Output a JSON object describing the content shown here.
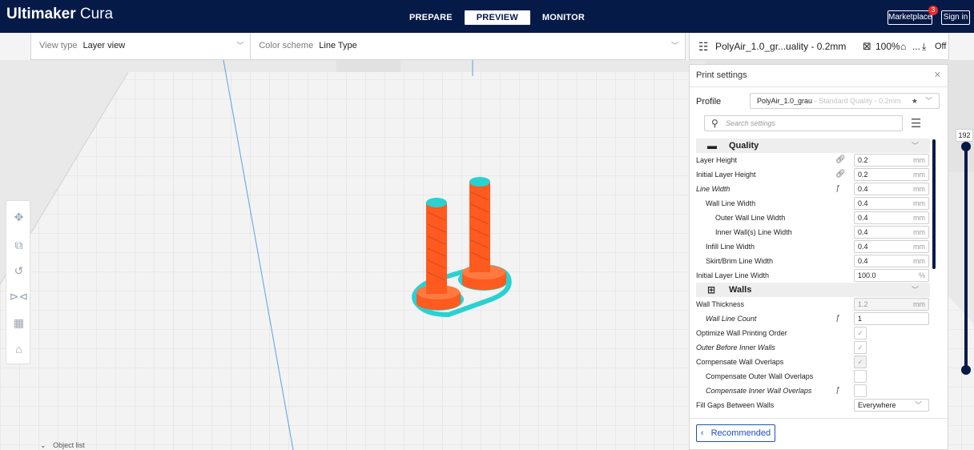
{
  "app": {
    "logo_bold": "Ultimaker",
    "logo_light": "Cura"
  },
  "stages": [
    "PREPARE",
    "PREVIEW",
    "MONITOR"
  ],
  "header": {
    "marketplace_label": "Marketplace",
    "marketplace_badge": "3",
    "signin_label": "Sign in"
  },
  "viewbar": {
    "view_type_label": "View type",
    "view_type_value": "Layer view",
    "color_scheme_label": "Color scheme",
    "color_scheme_value": "Line Type"
  },
  "printbar": {
    "profile": "PolyAir_1.0_gr...uality - 0.2mm",
    "infill": "100%",
    "support": "...",
    "adhesion": "Off"
  },
  "panel": {
    "title": "Print settings",
    "profile_label": "Profile",
    "profile_name": "PolyAir_1.0_grau",
    "profile_quality": "Standard Quality - 0.2mm",
    "search_placeholder": "Search settings",
    "recommended_label": "Recommended"
  },
  "categories": {
    "quality": "Quality",
    "walls": "Walls"
  },
  "quality_rows": [
    {
      "label": "Layer Height",
      "value": "0.2",
      "unit": "mm"
    },
    {
      "label": "Initial Layer Height",
      "value": "0.2",
      "unit": "mm"
    },
    {
      "label": "Line Width",
      "value": "0.4",
      "unit": "mm"
    },
    {
      "label": "Wall Line Width",
      "value": "0.4",
      "unit": "mm"
    },
    {
      "label": "Outer Wall Line Width",
      "value": "0.4",
      "unit": "mm"
    },
    {
      "label": "Inner Wall(s) Line Width",
      "value": "0.4",
      "unit": "mm"
    },
    {
      "label": "Infill Line Width",
      "value": "0.4",
      "unit": "mm"
    },
    {
      "label": "Skirt/Brim Line Width",
      "value": "0.4",
      "unit": "mm"
    },
    {
      "label": "Initial Layer Line Width",
      "value": "100.0",
      "unit": "%"
    }
  ],
  "walls_rows": [
    {
      "label": "Wall Thickness",
      "value": "1.2",
      "unit": "mm"
    },
    {
      "label": "Wall Line Count",
      "value": "1"
    },
    {
      "label": "Optimize Wall Printing Order"
    },
    {
      "label": "Outer Before Inner Walls"
    },
    {
      "label": "Compensate Wall Overlaps"
    },
    {
      "label": "Compensate Outer Wall Overlaps"
    },
    {
      "label": "Compensate Inner Wall Overlaps"
    },
    {
      "label": "Fill Gaps Between Walls",
      "value": "Everywhere"
    }
  ],
  "check_mark": "✓",
  "layer_slider": {
    "current_layer": "192",
    "upper_fraction": 1.0,
    "lower_fraction": 0.0
  },
  "object_list_label": "Object list",
  "colors": {
    "topbar": "#061a48",
    "model_orange": "#ff5a1f",
    "model_cyan": "#2ad1d1",
    "accent_blue": "#1f4fb8"
  }
}
